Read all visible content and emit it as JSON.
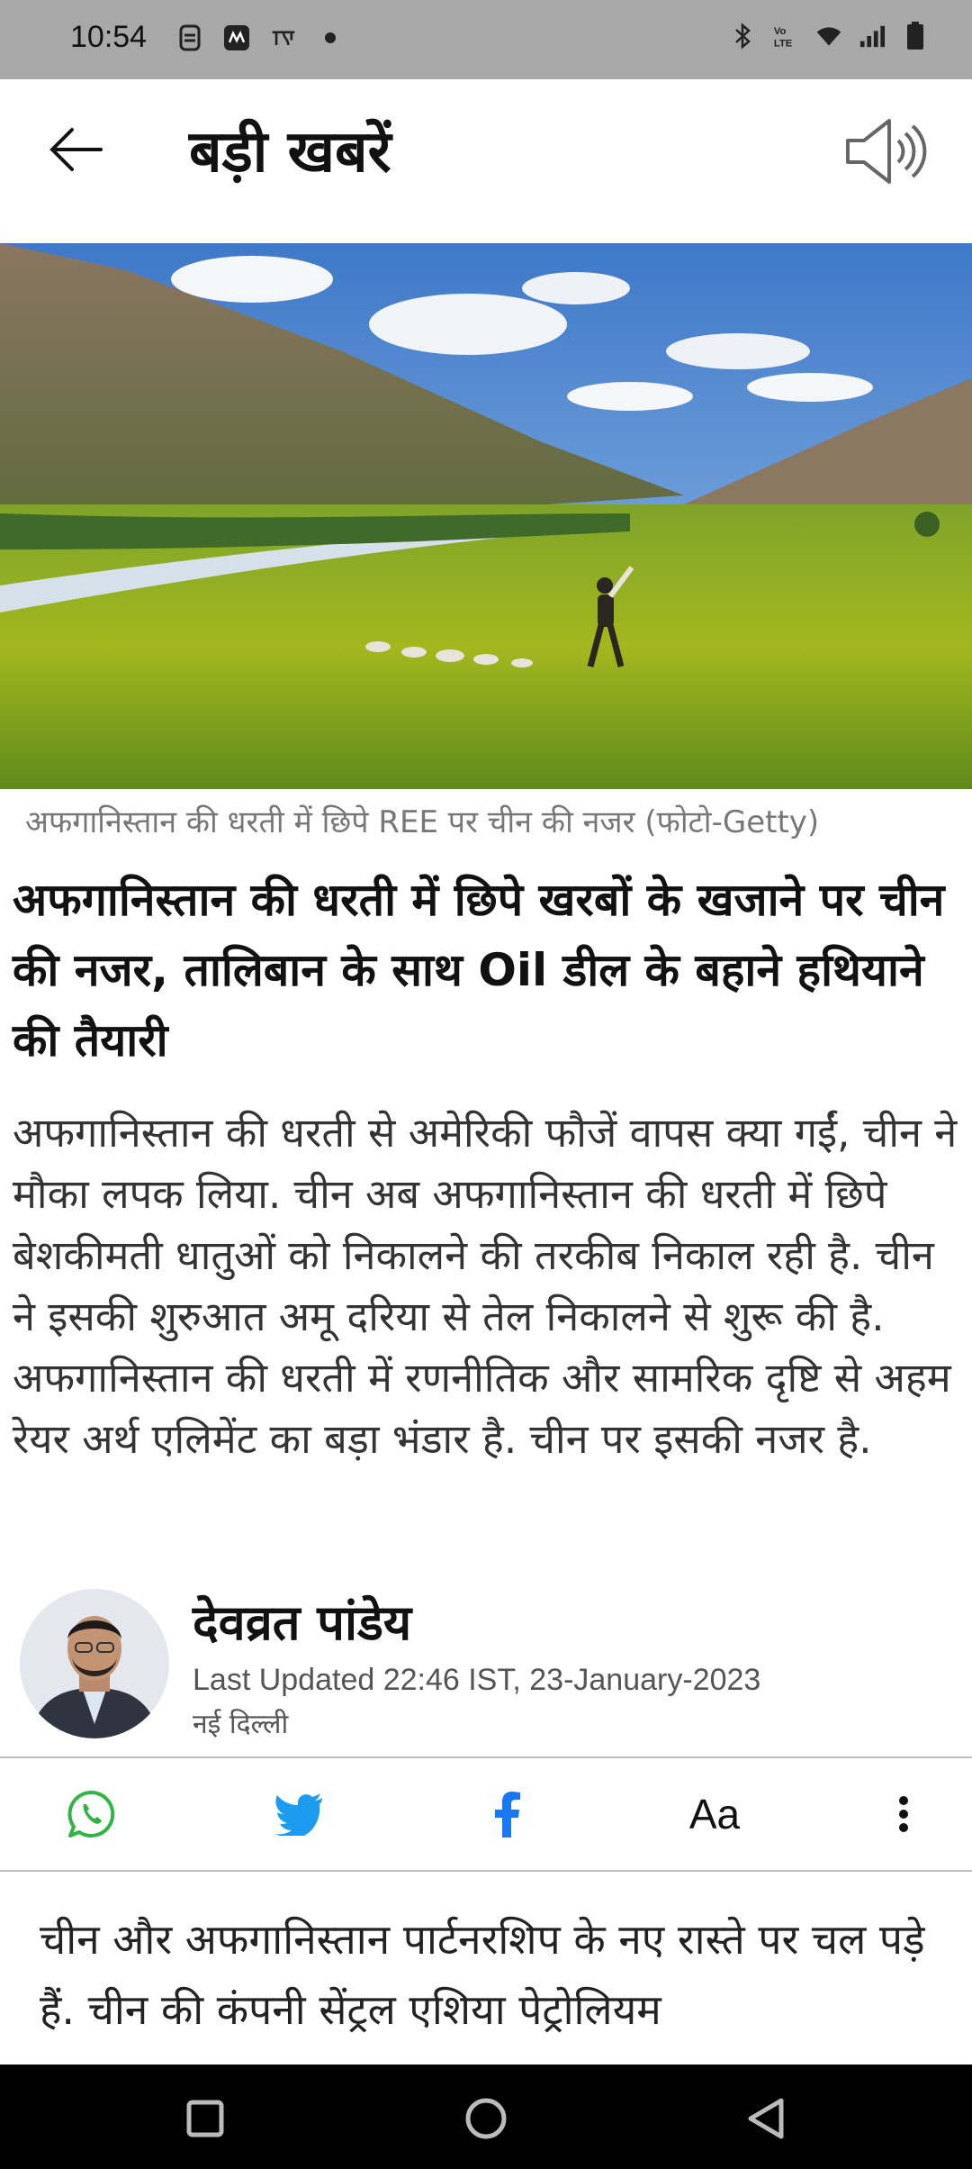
{
  "status_bar": {
    "time": "10:54"
  },
  "app_bar": {
    "title": "बड़ी खबरें"
  },
  "article": {
    "image_caption": "अफगानिस्तान की धरती में छिपे REE पर चीन की नजर (फोटो-Getty)",
    "headline": "अफगानिस्तान की धरती में छिपे खरबों के खजाने पर चीन की नजर, तालिबान के साथ Oil डील के बहाने हथियाने की तैयारी",
    "summary": "अफगानिस्तान की धरती से अमेरिकी फौजें वापस क्या गईं, चीन ने मौका लपक लिया. चीन अब अफगानिस्तान की धरती में छिपे बेशकीमती धातुओं को निकालने की तरकीब निकाल रही है. चीन ने इसकी शुरुआत अमू दरिया से तेल निकालने से शुरू की है. अफगानिस्तान की धरती में रणनीतिक और सामरिक दृष्टि से अहम रेयर अर्थ एलिमेंट का बड़ा भंडार है. चीन पर इसकी नजर है.",
    "author": {
      "name": "देवव्रत पांडेय",
      "updated": "Last Updated 22:46 IST, 23-January-2023",
      "location": "नई दिल्ली"
    },
    "share_bar": {
      "font_size_label": "Aa"
    },
    "body": "चीन और अफगानिस्तान पार्टनरशिप के नए रास्ते पर चल पड़े हैं. चीन की कंपनी सेंट्रल एशिया पेट्रोलियम"
  },
  "colors": {
    "whatsapp": "#2fb541",
    "twitter": "#1d9bf0",
    "facebook": "#1877f2",
    "status_bar_bg": "#a8a8a8"
  },
  "icons": [
    "back-arrow-icon",
    "speaker-icon",
    "whatsapp-icon",
    "twitter-icon",
    "facebook-icon",
    "more-vert-icon",
    "nav-recents-icon",
    "nav-home-icon",
    "nav-back-icon"
  ]
}
